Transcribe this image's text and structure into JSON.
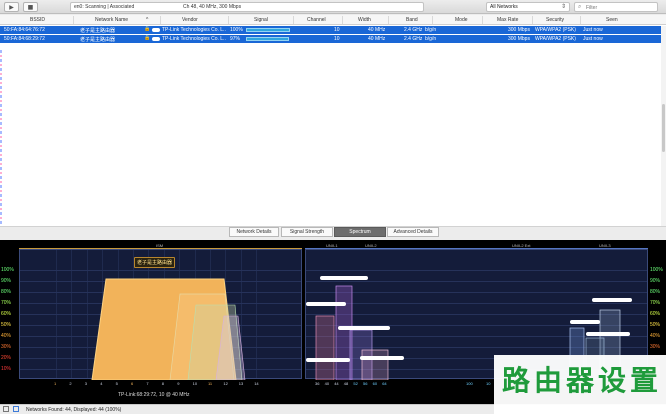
{
  "toolbar": {
    "play_icon": "play-icon",
    "stop_icon": "stop-icon",
    "status_left": "en0: Scanning | Associated",
    "status_right": "Ch 48, 40 MHz, 300 Mbps",
    "network_filter": "All Networks",
    "filter_placeholder": "Filter"
  },
  "table": {
    "columns": [
      "BSSID",
      "Network Name",
      "Vendor",
      "Signal",
      "Channel",
      "Width",
      "Band",
      "Mode",
      "Max Rate",
      "Security",
      "Seen"
    ],
    "rows": [
      {
        "bssid": "50:FA:84:64:76:72",
        "network_name": "老子是主路由器",
        "vendor": "TP-Link Technologies Co. L...",
        "signal": "100%",
        "signal_fraction": 1.0,
        "channel": "10",
        "width": "40 MHz",
        "band": "2.4 GHz",
        "mode": "b/g/n",
        "max_rate": "300 Mbps",
        "security": "WPA/WPA2 (PSK)",
        "seen": "Just now"
      },
      {
        "bssid": "50:FA:84:68:29:72",
        "network_name": "老子是主路由器",
        "vendor": "TP-Link Technologies Co. L...",
        "signal": "97%",
        "signal_fraction": 0.97,
        "channel": "10",
        "width": "40 MHz",
        "band": "2.4 GHz",
        "mode": "b/g/n",
        "max_rate": "300 Mbps",
        "security": "WPA/WPA2 (PSK)",
        "seen": "Just now"
      }
    ]
  },
  "tabs": [
    {
      "label": "Network Details",
      "active": false
    },
    {
      "label": "Signal Strength",
      "active": false
    },
    {
      "label": "Spectrum",
      "active": true
    },
    {
      "label": "Advanced Details",
      "active": false
    }
  ],
  "spectrum": {
    "band_24_header": "ISM",
    "band_5_headers": [
      "UNII-1",
      "UNII-2",
      "UNII-2 Ext",
      "UNII-3"
    ],
    "y_ticks": [
      "100%",
      "90%",
      "80%",
      "70%",
      "60%",
      "50%",
      "40%",
      "30%",
      "20%",
      "10%"
    ],
    "x_ticks_24": [
      "1",
      "2",
      "3",
      "4",
      "5",
      "6",
      "7",
      "8",
      "9",
      "10",
      "11",
      "12",
      "13",
      "14"
    ],
    "x_ticks_24_highlight": [
      "1",
      "6",
      "11"
    ],
    "x_ticks_5": [
      "36",
      "40",
      "44",
      "48",
      "52",
      "56",
      "60",
      "64"
    ],
    "x_ticks_5_right": [
      "100",
      "10"
    ],
    "selected_ssid": "老子是主路由器",
    "selected_caption": "TP-Link:68:29:72, 10 @ 40 MHz",
    "accent": "#f2b35a"
  },
  "footer": {
    "status": "Networks Found: 44, Displayed: 44 (100%)"
  },
  "watermark": {
    "text": "路由器设置"
  }
}
